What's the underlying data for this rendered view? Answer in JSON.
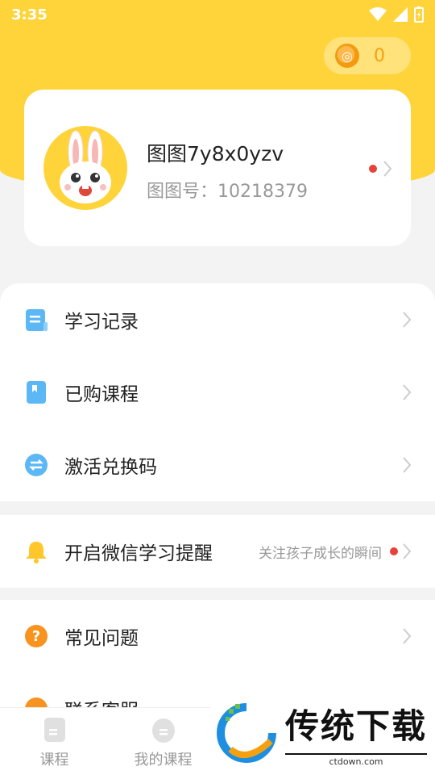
{
  "status_bar": {
    "time": "3:35"
  },
  "coins": {
    "value": "0"
  },
  "profile": {
    "username": "图图7y8x0yzv",
    "id_text": "图图号：10218379"
  },
  "menu_group1": [
    {
      "label": "学习记录",
      "icon": "study-record-icon",
      "color": "#5bb8f5"
    },
    {
      "label": "已购课程",
      "icon": "purchased-course-icon",
      "color": "#5bb8f5"
    },
    {
      "label": "激活兑换码",
      "icon": "redeem-code-icon",
      "color": "#5bb8f5"
    }
  ],
  "menu_group2": [
    {
      "label": "开启微信学习提醒",
      "hint": "关注孩子成长的瞬间",
      "icon": "bell-icon",
      "color": "#ffc72c"
    }
  ],
  "menu_group3": [
    {
      "label": "常见问题",
      "icon": "question-icon",
      "color": "#f7931e"
    },
    {
      "label": "联系客服",
      "icon": "customer-service-icon",
      "color": "#f7931e"
    }
  ],
  "tabbar": {
    "tabs": [
      {
        "label": "课程",
        "icon": "course-tab-icon"
      },
      {
        "label": "我的课程",
        "icon": "my-course-tab-icon"
      }
    ]
  },
  "watermark": {
    "title": "传统下载",
    "subtitle": "ctdown.com"
  },
  "colors": {
    "accent": "#ffd43b",
    "red_dot": "#e8413a",
    "coin": "#f5a010"
  }
}
